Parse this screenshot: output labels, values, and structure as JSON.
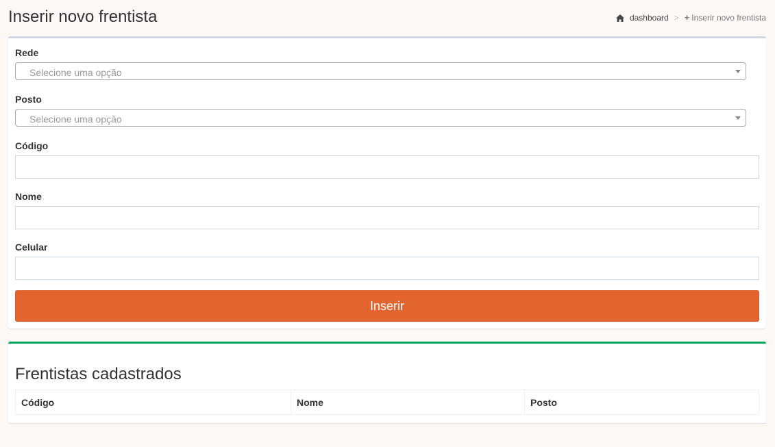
{
  "header": {
    "title": "Inserir novo frentista",
    "breadcrumb": {
      "home_icon": "home-icon",
      "home_label": "dashboard",
      "separator": ">",
      "current_icon": "plus-icon",
      "current_label": "Inserir novo frentista"
    }
  },
  "form": {
    "rede": {
      "label": "Rede",
      "placeholder": "Selecione uma opção"
    },
    "posto": {
      "label": "Posto",
      "placeholder": "Selecione uma opção"
    },
    "codigo": {
      "label": "Código",
      "value": ""
    },
    "nome": {
      "label": "Nome",
      "value": ""
    },
    "celular": {
      "label": "Celular",
      "value": ""
    },
    "submit_label": "Inserir"
  },
  "list": {
    "title": "Frentistas cadastrados",
    "columns": [
      "Código",
      "Nome",
      "Posto"
    ],
    "rows": []
  },
  "colors": {
    "accent": "#e2642f",
    "list_border": "#00a65a",
    "form_border": "#d2d6de",
    "background": "#fdf8f6"
  }
}
